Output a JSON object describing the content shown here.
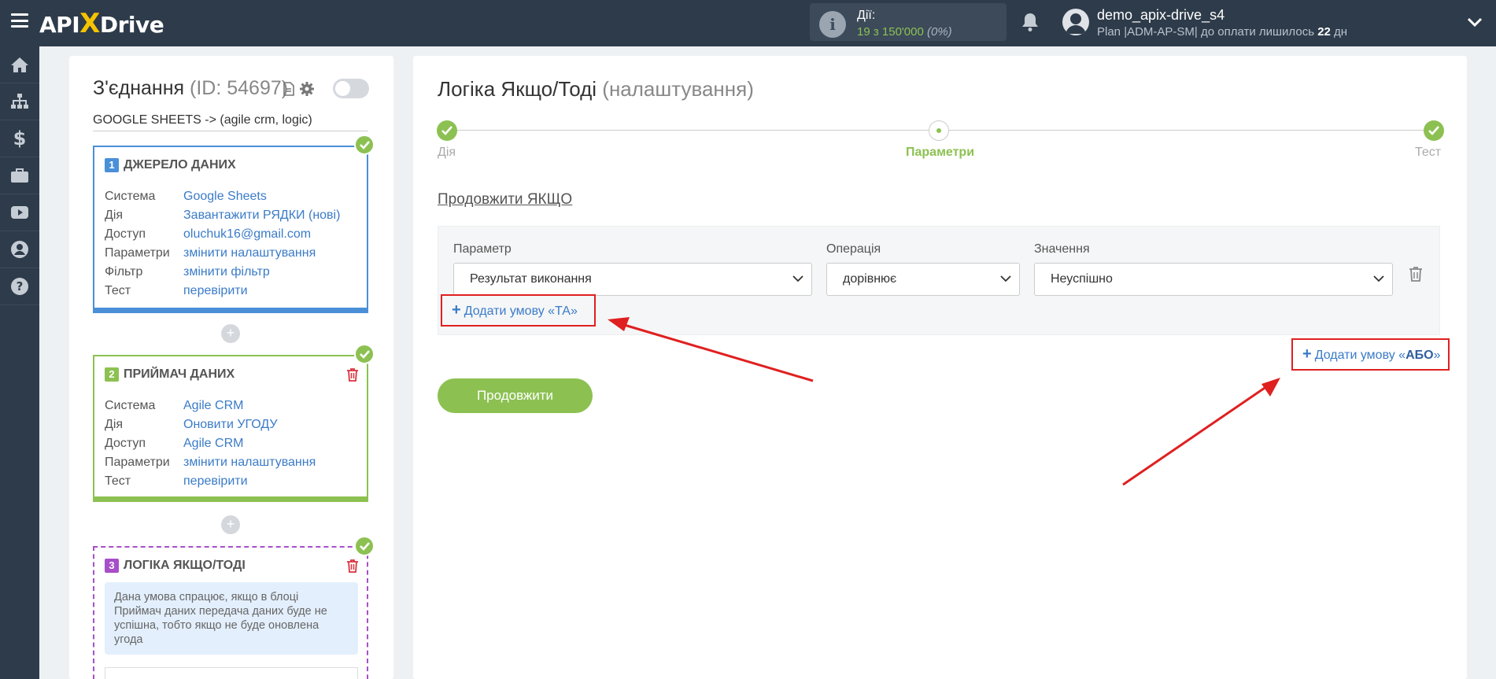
{
  "header": {
    "logo_prefix": "API",
    "logo_x": "X",
    "logo_suffix": "Drive",
    "actions_label": "Дії:",
    "actions_count": "19 з 150'000",
    "actions_pct": "(0%)",
    "user_name": "demo_apix-drive_s4",
    "plan_text": "Plan |ADM-AP-SM| до оплати лишилось ",
    "plan_days": "22",
    "plan_days_unit": " дн"
  },
  "sidebar": {
    "icons": [
      "home-icon",
      "sitemap-icon",
      "dollar-icon",
      "briefcase-icon",
      "youtube-icon",
      "user-circle-icon",
      "help-icon"
    ]
  },
  "connection": {
    "title": "З'єднання",
    "id_text": "(ID: 54697)",
    "subtitle": "GOOGLE SHEETS -> (agile crm, logic)",
    "blocks": [
      {
        "number": "1",
        "title": "ДЖЕРЕЛО ДАНИХ",
        "rows": [
          {
            "key": "Система",
            "value": "Google Sheets"
          },
          {
            "key": "Дія",
            "value": "Завантажити РЯДКИ (нові)"
          },
          {
            "key": "Доступ",
            "value": "oluchuk16@gmail.com"
          },
          {
            "key": "Параметри",
            "value": "змінити налаштування"
          },
          {
            "key": "Фільтр",
            "value": "змінити фільтр"
          },
          {
            "key": "Тест",
            "value": "перевірити"
          }
        ]
      },
      {
        "number": "2",
        "title": "ПРИЙМАЧ ДАНИХ",
        "rows": [
          {
            "key": "Система",
            "value": "Agile CRM"
          },
          {
            "key": "Дія",
            "value": "Оновити УГОДУ"
          },
          {
            "key": "Доступ",
            "value": "Agile CRM"
          },
          {
            "key": "Параметри",
            "value": "змінити налаштування"
          },
          {
            "key": "Тест",
            "value": "перевірити"
          }
        ]
      },
      {
        "number": "3",
        "title": "ЛОГІКА ЯКЩО/ТОДІ",
        "note": "Дана умова спрацює, якщо в блоці Приймач даних передача даних буде не успішна, тобто якщо не буде оновлена угода"
      }
    ]
  },
  "main": {
    "title": "Логіка Якщо/Тоді",
    "title_sub": "(налаштування)",
    "steps": [
      "Дія",
      "Параметри",
      "Тест"
    ],
    "section_title": "Продовжити ЯКЩО",
    "condition": {
      "param_label": "Параметр",
      "param_value": "Результат виконання",
      "op_label": "Операція",
      "op_value": "дорівнює",
      "value_label": "Значення",
      "value_value": "Неуспішно"
    },
    "add_and_text": "Додати умову «ТА»",
    "add_or_text": "Додати умову «",
    "add_or_strong": "АБО",
    "add_or_end": "»",
    "continue_label": "Продовжити"
  },
  "colors": {
    "topbar": "#2e3b4a",
    "green": "#8cc152",
    "blue": "#4a8fd8",
    "purple": "#a74fc9",
    "red_highlight": "#e02020",
    "link": "#3a7bc8"
  }
}
